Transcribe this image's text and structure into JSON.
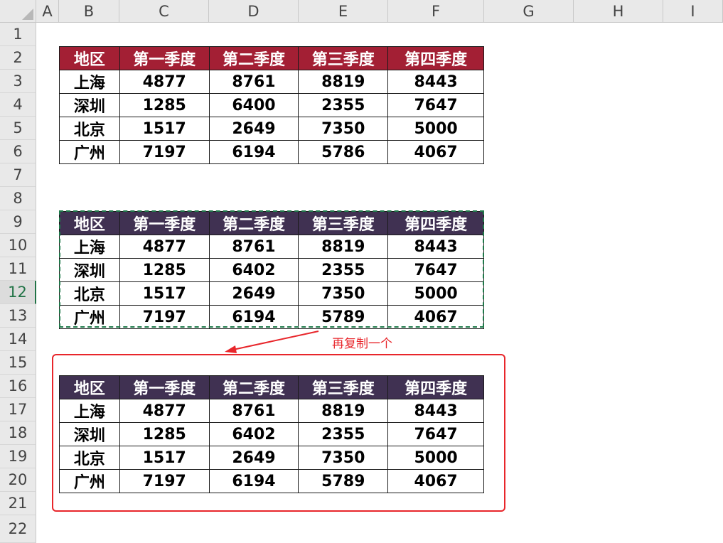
{
  "columns": [
    "A",
    "B",
    "C",
    "D",
    "E",
    "F",
    "G",
    "H",
    "I"
  ],
  "rows": [
    "1",
    "2",
    "3",
    "4",
    "5",
    "6",
    "7",
    "8",
    "9",
    "10",
    "11",
    "12",
    "13",
    "14",
    "15",
    "16",
    "17",
    "18",
    "19",
    "20",
    "21",
    "22"
  ],
  "active_row": "12",
  "table_headers": [
    "地区",
    "第一季度",
    "第二季度",
    "第三季度",
    "第四季度"
  ],
  "table1": [
    [
      "上海",
      "4877",
      "8761",
      "8819",
      "8443"
    ],
    [
      "深圳",
      "1285",
      "6400",
      "2355",
      "7647"
    ],
    [
      "北京",
      "1517",
      "2649",
      "7350",
      "5000"
    ],
    [
      "广州",
      "7197",
      "6194",
      "5786",
      "4067"
    ]
  ],
  "table2": [
    [
      "上海",
      "4877",
      "8761",
      "8819",
      "8443"
    ],
    [
      "深圳",
      "1285",
      "6402",
      "2355",
      "7647"
    ],
    [
      "北京",
      "1517",
      "2649",
      "7350",
      "5000"
    ],
    [
      "广州",
      "7197",
      "6194",
      "5789",
      "4067"
    ]
  ],
  "table3": [
    [
      "上海",
      "4877",
      "8761",
      "8819",
      "8443"
    ],
    [
      "深圳",
      "1285",
      "6402",
      "2355",
      "7647"
    ],
    [
      "北京",
      "1517",
      "2649",
      "7350",
      "5000"
    ],
    [
      "广州",
      "7197",
      "6194",
      "5789",
      "4067"
    ]
  ],
  "annotation": "再复制一个",
  "colors": {
    "header_red": "#a31f34",
    "header_purple": "#403152",
    "annotation_red": "#e8262b",
    "selection_green": "#1f7a4a"
  }
}
